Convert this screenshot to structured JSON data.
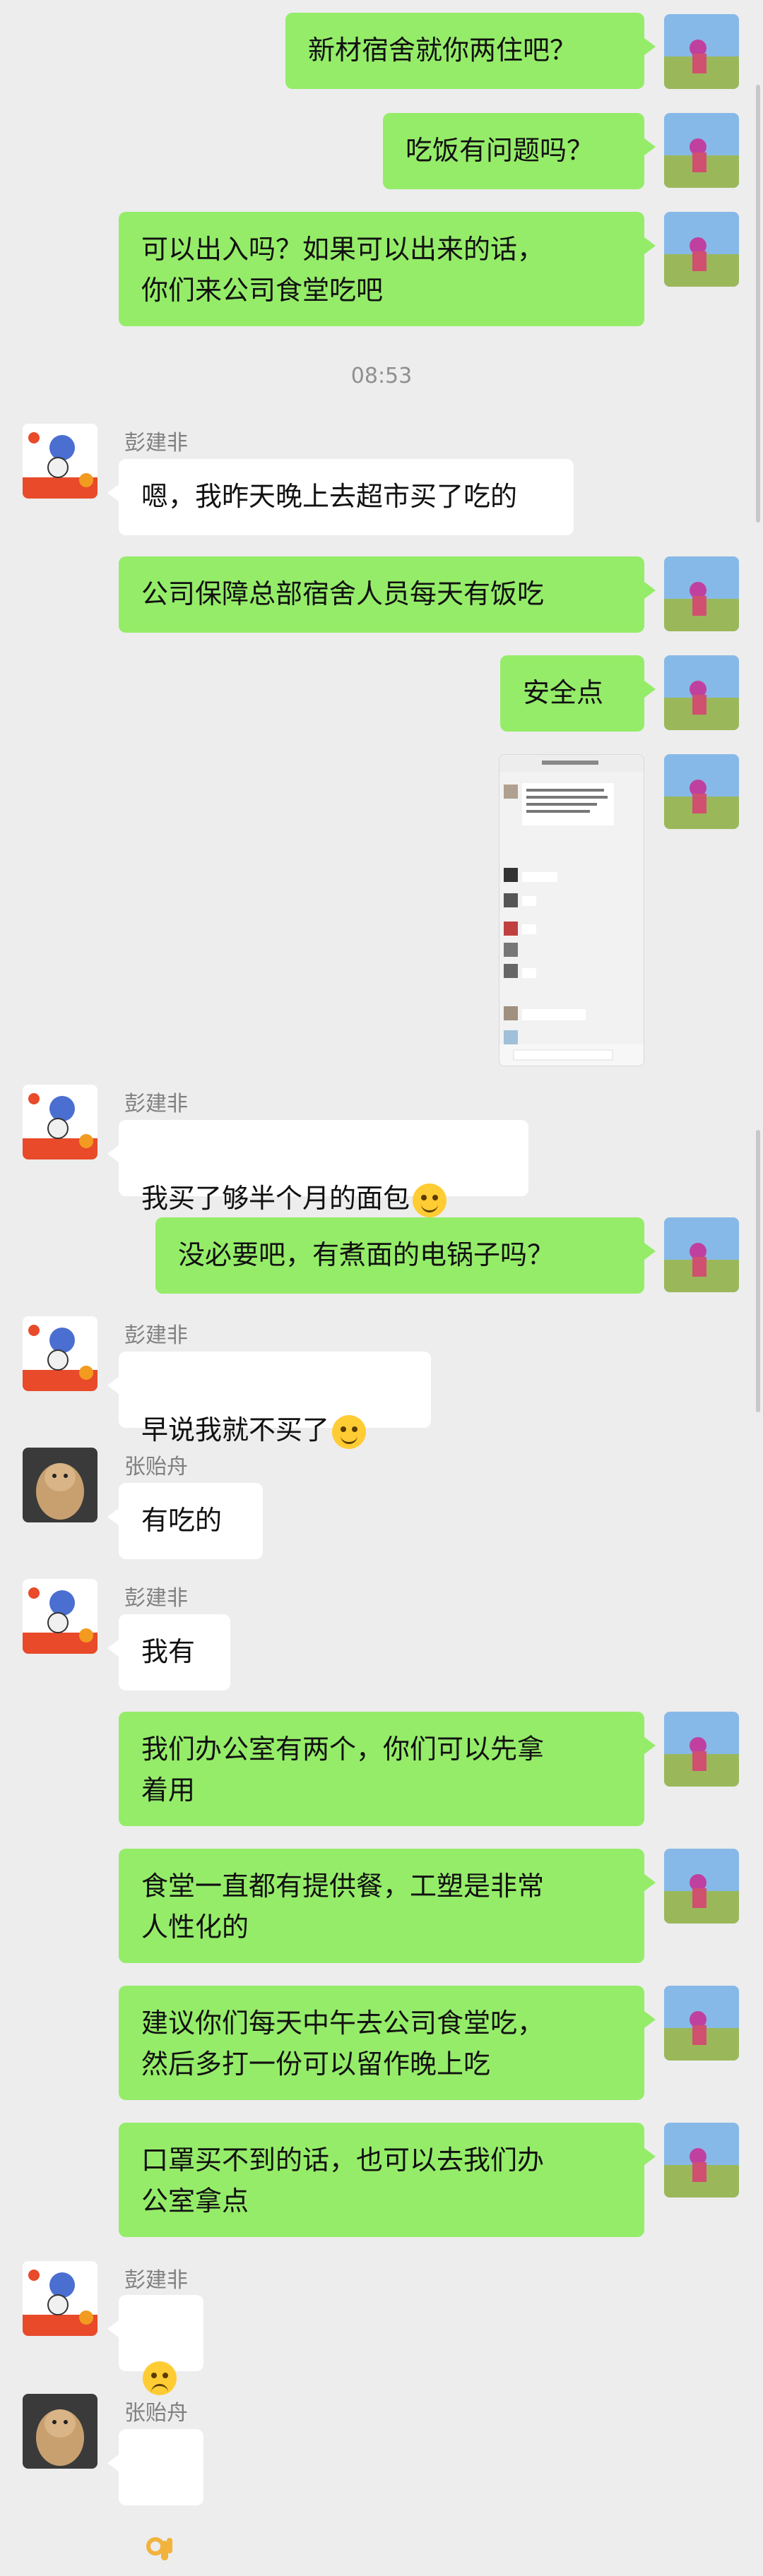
{
  "contacts": {
    "peng": "彭建非",
    "zhang": "张贻舟"
  },
  "time_divider": "08:53",
  "messages": {
    "m1": "新材宿舍就你两住吧？",
    "m2": "吃饭有问题吗？",
    "m3": "可以出入吗？如果可以出来的话，\n你们来公司食堂吃吧",
    "m4": "嗯，我昨天晚上去超市买了吃的",
    "m5": "公司保障总部宿舍人员每天有饭吃",
    "m6": "安全点",
    "m8": "我买了够半个月的面包",
    "m9": "没必要吧，有煮面的电锅子吗？",
    "m10": "早说我就不买了",
    "m11": "有吃的",
    "m12": "我有",
    "m13": "我们办公室有两个，你们可以先拿\n着用",
    "m14": "食堂一直都有提供餐，工塑是非常\n人性化的",
    "m15": "建议你们每天中午去公司食堂吃，\n然后多打一份可以留作晚上吃",
    "m16": "口罩买不到的话，也可以去我们办\n公室拿点"
  },
  "emoji": {
    "m8": "laughing-tears-emoji",
    "m10": "laughing-tears-emoji",
    "m17": "thinking-emoji",
    "m18": "ok-hand-emoji"
  },
  "colors": {
    "background": "#ededed",
    "sent_bubble": "#95ec69",
    "received_bubble": "#ffffff",
    "name_text": "#808080"
  }
}
